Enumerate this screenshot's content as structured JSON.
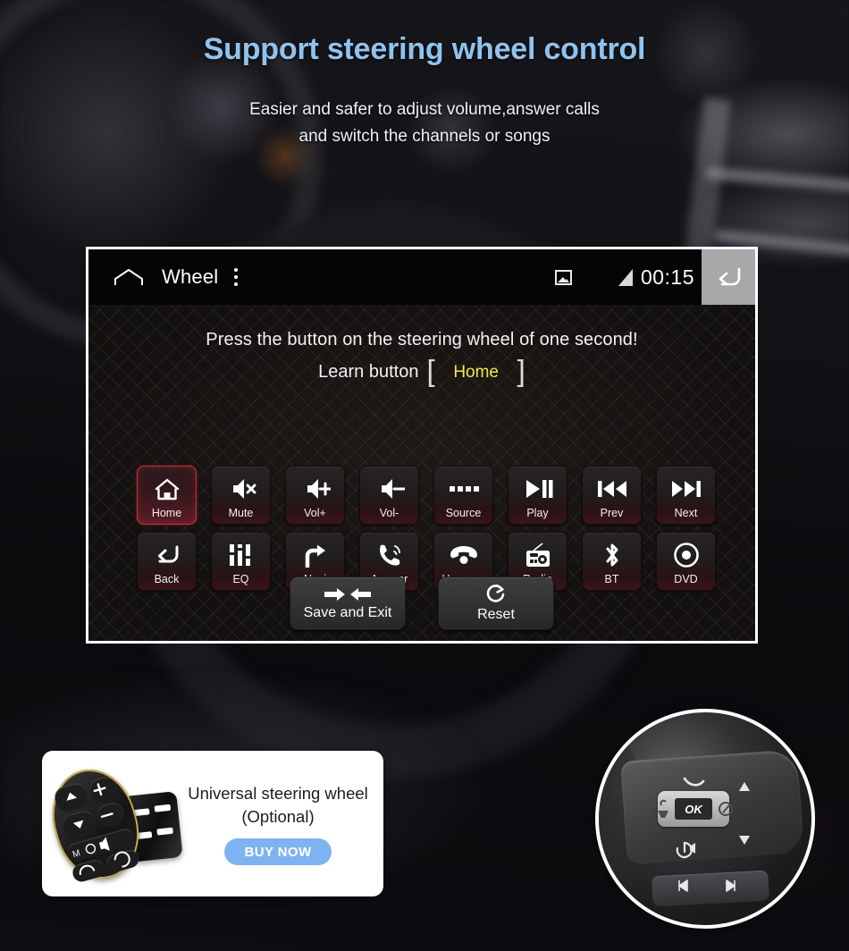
{
  "hero": {
    "headline": "Support steering wheel control",
    "sub_line_1": "Easier and safer to adjust volume,answer calls",
    "sub_line_2": "and switch the channels or songs",
    "headline_color": "#8fc3ee"
  },
  "device": {
    "statusbar": {
      "home_icon": "home-outline-icon",
      "title": "Wheel",
      "overflow_icon": "overflow-menu-icon",
      "image_icon": "picture-icon",
      "signal_icon": "signal-triangle-icon",
      "time": "00:15",
      "back_icon": "back-arrow-icon"
    },
    "prompt": {
      "line1": "Press the button on the steering wheel of one second!",
      "learn_label": "Learn button",
      "bracket_left": "[",
      "bracket_right": "]",
      "learn_value": "Home",
      "learn_value_color": "#f4e64a"
    },
    "buttons": [
      {
        "label": "Home",
        "icon": "home-icon",
        "active": true
      },
      {
        "label": "Mute",
        "icon": "volume-mute-icon",
        "active": false
      },
      {
        "label": "Vol+",
        "icon": "volume-up-icon",
        "active": false
      },
      {
        "label": "Vol-",
        "icon": "volume-down-icon",
        "active": false
      },
      {
        "label": "Source",
        "icon": "source-dots-icon",
        "active": false
      },
      {
        "label": "Play",
        "icon": "play-pause-icon",
        "active": false
      },
      {
        "label": "Prev",
        "icon": "previous-track-icon",
        "active": false
      },
      {
        "label": "Next",
        "icon": "next-track-icon",
        "active": false
      },
      {
        "label": "Back",
        "icon": "back-undo-icon",
        "active": false
      },
      {
        "label": "EQ",
        "icon": "equalizer-icon",
        "active": false
      },
      {
        "label": "Navi",
        "icon": "turn-right-arrow-icon",
        "active": false
      },
      {
        "label": "Answer",
        "icon": "phone-answer-icon",
        "active": false
      },
      {
        "label": "Hang-up",
        "icon": "phone-hangup-icon",
        "active": false
      },
      {
        "label": "Radio",
        "icon": "radio-icon",
        "active": false
      },
      {
        "label": "BT",
        "icon": "bluetooth-icon",
        "active": false
      },
      {
        "label": "DVD",
        "icon": "disc-icon",
        "active": false
      }
    ],
    "actions": [
      {
        "label": "Save and Exit",
        "icon": "arrows-inward-icon"
      },
      {
        "label": "Reset",
        "icon": "refresh-circle-icon"
      }
    ],
    "highlight_color": "#c0303a"
  },
  "promo": {
    "title_line_1": "Universal steering wheel",
    "title_line_2": "(Optional)",
    "buy_label": "BUY NOW",
    "buy_color": "#7fb2f0",
    "product_icon": "universal-steering-wheel-remote-photo"
  },
  "circle_photo": {
    "icon": "steering-wheel-buttons-photo",
    "ok_label": "OK"
  }
}
